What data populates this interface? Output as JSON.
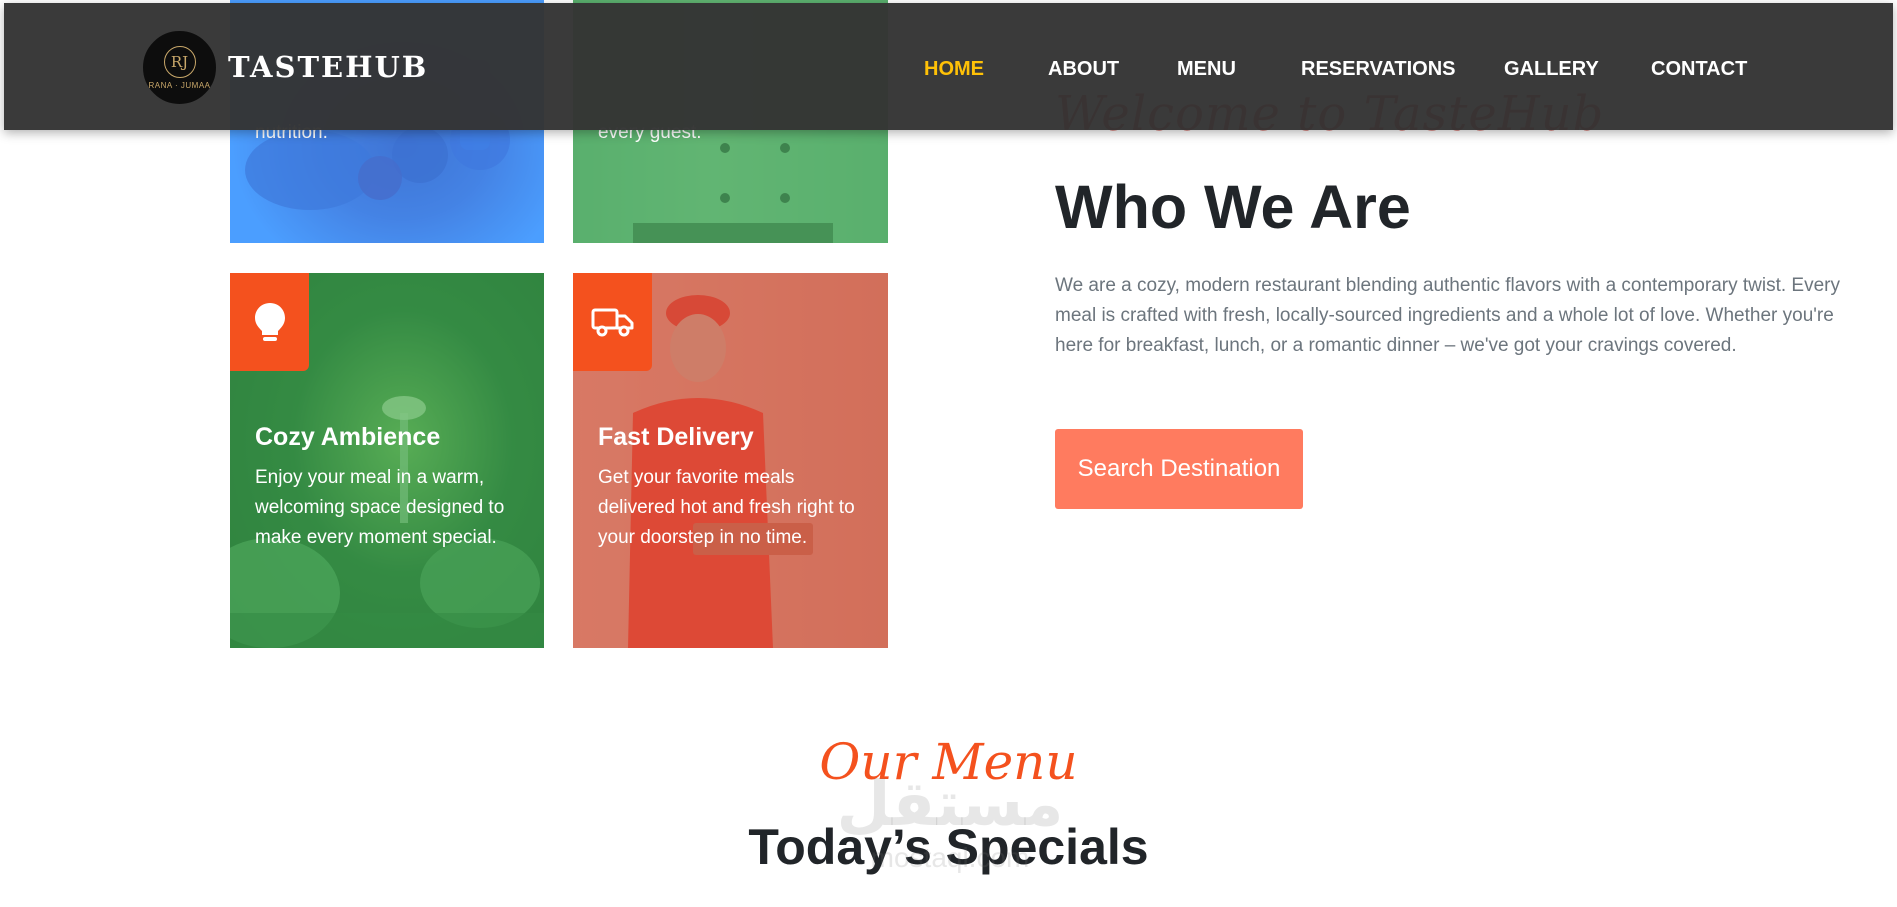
{
  "brand": {
    "logo_monogram": "RJ",
    "logo_subtext": "RANA · JUMAA",
    "name": "TASTEHUB"
  },
  "nav": {
    "items": [
      {
        "label": "HOME",
        "active": true
      },
      {
        "label": "ABOUT",
        "active": false
      },
      {
        "label": "MENU",
        "active": false
      },
      {
        "label": "RESERVATIONS",
        "active": false
      },
      {
        "label": "GALLERY",
        "active": false
      },
      {
        "label": "CONTACT",
        "active": false
      }
    ]
  },
  "features": {
    "health": {
      "text": "nutrition."
    },
    "chef": {
      "text": "every guest."
    },
    "ambience": {
      "title": "Cozy Ambience",
      "text": "Enjoy your meal in a warm, welcoming space designed to make every moment special."
    },
    "delivery": {
      "title": "Fast Delivery",
      "text": "Get your favorite meals delivered hot and fresh right to your doorstep in no time."
    }
  },
  "about": {
    "script_heading": "Welcome to TasteHub",
    "title": "Who We Are",
    "text": "We are a cozy, modern restaurant blending authentic flavors with a contemporary twist. Every meal is crafted with fresh, locally-sourced ingredients and a whole lot of love. Whether you're here for breakfast, lunch, or a romantic dinner – we've got your cravings covered.",
    "cta_label": "Search Destination"
  },
  "menu_section": {
    "script_heading": "Our Menu",
    "title": "Today’s Specials"
  },
  "watermark": {
    "arabic": "مستقل",
    "latin": "mostaql.com"
  },
  "colors": {
    "accent": "#f4511e",
    "cta": "#ff7b5f",
    "nav_active": "#ffc107",
    "navbar_bg": "#343434"
  }
}
